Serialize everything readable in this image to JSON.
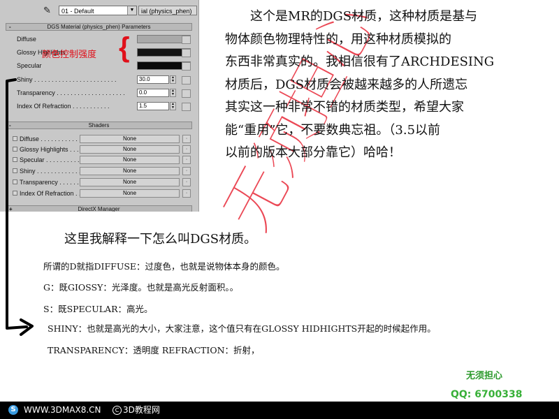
{
  "panel": {
    "material_name": "01 - Default",
    "material_type": "ial (physics_phen)",
    "params_rollout_title": "DGS Material (physics_phen) Parameters",
    "params": [
      {
        "label": "Diffuse",
        "kind": "color",
        "color": "#a9a9a9"
      },
      {
        "label": "Glossy Highlights",
        "kind": "color",
        "color": "#141414"
      },
      {
        "label": "Specular",
        "kind": "color",
        "color": "#0a0a0a"
      },
      {
        "label": "Shiny",
        "kind": "spinner",
        "value": "30.0"
      },
      {
        "label": "Transparency",
        "kind": "spinner",
        "value": "0.0"
      },
      {
        "label": "Index Of Refraction",
        "kind": "spinner",
        "value": "1.5"
      }
    ],
    "shaders_rollout_title": "Shaders",
    "shaders": [
      {
        "label": "Diffuse . . . . . . . . . . . .",
        "value": "None"
      },
      {
        "label": "Glossy Highlights . . . . . .",
        "value": "None"
      },
      {
        "label": "Specular . . . . . . . . . . .",
        "value": "None"
      },
      {
        "label": "Shiny . . . . . . . . . . . . .",
        "value": "None"
      },
      {
        "label": "Transparency . . . . . . . .",
        "value": "None"
      },
      {
        "label": "Index Of Refraction . . .",
        "value": "None"
      }
    ],
    "next_rollout_title": "DirectX Manager",
    "annotation": "颜色控制强度"
  },
  "intro_lines": [
    "这个是MR的DGS材质，这种材质是基与",
    "物体颜色物理特性的，用这种材质模拟的",
    "东西非常真实的。我相信很有了ARCHDESING",
    "材质后，DGS材质会被越来越多的人所遗忘",
    "其实这一种非常不错的材质类型，希望大家",
    "能“重用”它，不要数典忘祖。（3.5以前",
    "以前的版本大部分靠它）哈哈！"
  ],
  "explain_heading": "这里我解释一下怎么叫DGS材质。",
  "explain_lines": {
    "d": "所谓的D就指DIFFUSE：过度色，也就是说物体本身的颜色。",
    "g": "G：既GIOSSY：光泽度。也就是高光反射面积。。",
    "s": "S：既SPECULAR：高光。",
    "shiny": "SHINY：也就是高光的大小，大家注意，这个值只有在GLOSSY HIDHIGHTS开起的时候起作用。",
    "tr": "TRANSPARENCY：透明度    REFRACTION：折射，"
  },
  "watermark": "无须担心",
  "signature": {
    "name": "无须担心",
    "qq": "QQ: 6700338"
  },
  "footer": {
    "logo": "S",
    "url": "WWW.3DMAX8.CN",
    "symbol": "C",
    "site": "3D教程网"
  },
  "colors": {
    "annotation": "#e0101a",
    "watermark": "#e82837",
    "signature": "#38b038"
  }
}
